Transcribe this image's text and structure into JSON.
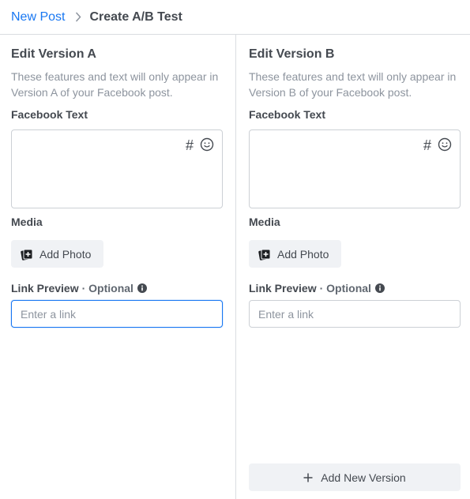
{
  "breadcrumb": {
    "parent": "New Post",
    "current": "Create A/B Test"
  },
  "versions": [
    {
      "title": "Edit Version A",
      "description": "These features and text will only appear in Version A of your Facebook post.",
      "facebook_text_label": "Facebook Text",
      "hashtag_symbol": "#",
      "media_label": "Media",
      "add_photo_label": "Add Photo",
      "link_preview_label": "Link Preview",
      "optional_label": "· Optional",
      "link_placeholder": "Enter a link",
      "link_value": ""
    },
    {
      "title": "Edit Version B",
      "description": "These features and text will only appear in Version B of your Facebook post.",
      "facebook_text_label": "Facebook Text",
      "hashtag_symbol": "#",
      "media_label": "Media",
      "add_photo_label": "Add Photo",
      "link_preview_label": "Link Preview",
      "optional_label": "· Optional",
      "link_placeholder": "Enter a link",
      "link_value": ""
    }
  ],
  "add_version_label": "Add New Version",
  "colors": {
    "link_blue": "#1877f2",
    "focus_border": "#1877f2",
    "button_bg": "#f0f2f5",
    "border": "#ccd0d5",
    "muted_text": "#8d949e"
  },
  "icons": {
    "breadcrumb_separator": "chevron-right-icon",
    "hashtag": "hashtag-icon",
    "emoji": "smiley-icon",
    "add_photo": "add-photo-icon",
    "info": "info-icon",
    "add_version": "plus-icon"
  }
}
